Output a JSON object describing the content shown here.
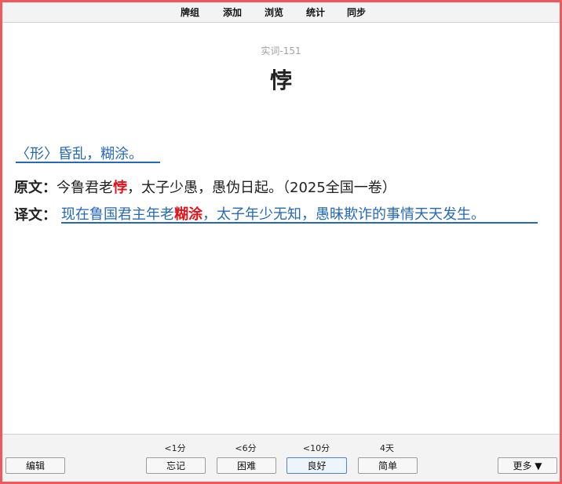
{
  "topbar": {
    "menus": [
      {
        "label": "牌组"
      },
      {
        "label": "添加"
      },
      {
        "label": "浏览"
      },
      {
        "label": "统计"
      },
      {
        "label": "同步"
      }
    ]
  },
  "card": {
    "deck_name": "实词-151",
    "headword": "悖",
    "definition": "〈形〉昏乱，糊涂。",
    "original": {
      "label": "原文：",
      "before": "今鲁君老",
      "highlight": "悖",
      "after": "，太子少愚，愚伪日起。（2025全国一卷）"
    },
    "translation": {
      "label": "译文：",
      "before": "现在鲁国君主年老",
      "highlight": "糊涂",
      "after": "，太子年少无知，愚昧欺诈的事情天天发生。"
    }
  },
  "bottombar": {
    "edit_label": "编辑",
    "more_label": "更多 ▼",
    "answers": [
      {
        "interval": "<1分",
        "label": "忘记"
      },
      {
        "interval": "<6分",
        "label": "困难"
      },
      {
        "interval": "<10分",
        "label": "良好"
      },
      {
        "interval": "4天",
        "label": "简单"
      }
    ]
  },
  "colors": {
    "border": "#f0585c",
    "link_blue": "#2569b8",
    "highlight_red": "#e1141c"
  }
}
